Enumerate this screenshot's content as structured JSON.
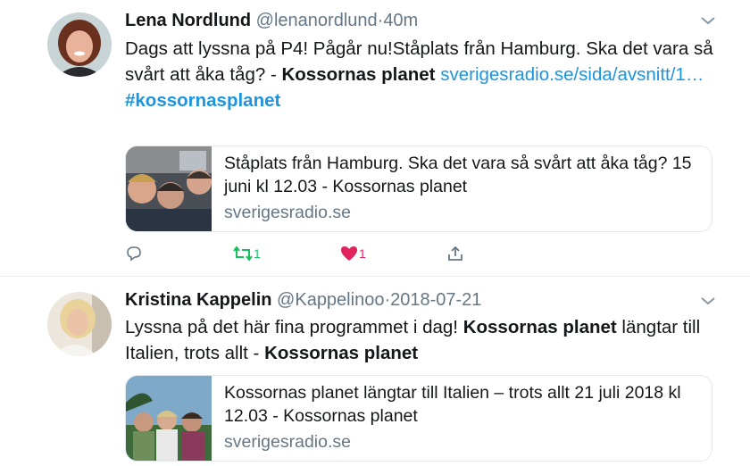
{
  "tweets": [
    {
      "name": "Lena Nordlund",
      "handle": "@lenanordlund",
      "separator": "·",
      "time": "40m",
      "text_plain": "Dags att lyssna på P4! Pågår nu!Ståplats från Hamburg. Ska det vara så svårt att åka tåg? - ",
      "text_bold": "Kossornas planet",
      "link": "sverigesradio.se/sida/avsnitt/1…",
      "hashtag": "#kossornasplanet",
      "card": {
        "title": "Ståplats från Hamburg. Ska det vara så svårt att åka tåg? 15 juni kl 12.03 - Kossornas planet",
        "domain": "sverigesradio.se"
      },
      "actions": {
        "reply_count": "",
        "retweet_count": "1",
        "like_count": "1"
      },
      "colors": {
        "retweet": "#17bf63",
        "like": "#e0245e",
        "neutral": "#657786"
      }
    },
    {
      "name": "Kristina Kappelin",
      "handle": "@Kappelinoo",
      "separator": "·",
      "time": "2018-07-21",
      "text_plain": "Lyssna på det här fina programmet i dag! ",
      "text_bold": "Kossornas planet",
      "text_plain2": " längtar till Italien, trots allt - ",
      "text_bold2": "Kossornas planet",
      "card": {
        "title": "Kossornas planet längtar till Italien – trots allt 21 juli 2018 kl 12.03 - Kossornas planet",
        "domain": "sverigesradio.se"
      }
    }
  ],
  "icons": {
    "reply": "reply-icon",
    "retweet": "retweet-icon",
    "like": "heart-icon",
    "share": "share-icon",
    "caret": "chevron-down-icon"
  },
  "link_color": "#1b95e0"
}
